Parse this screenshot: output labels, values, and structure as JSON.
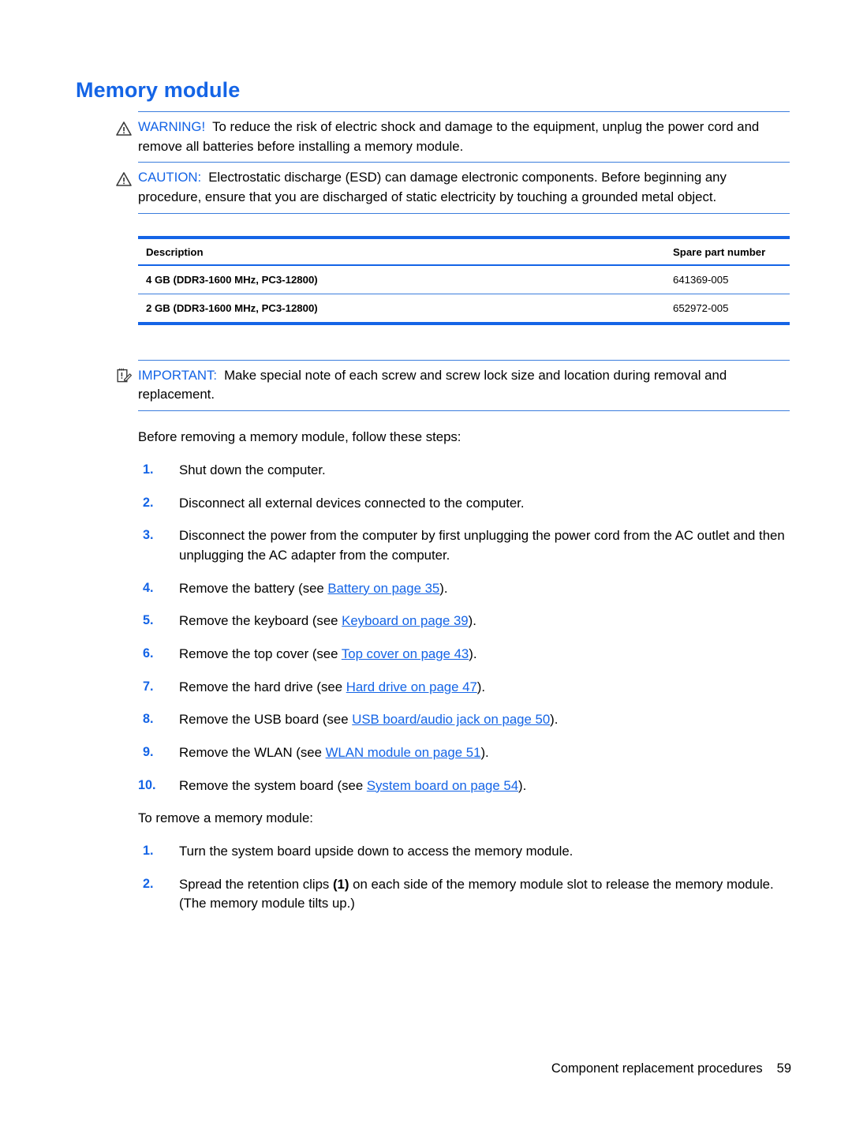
{
  "page": {
    "title": "Memory module",
    "heading_color": "#1464E6"
  },
  "admonitions": [
    {
      "icon": "warning-triangle-icon",
      "label": "WARNING!",
      "text": "To reduce the risk of electric shock and damage to the equipment, unplug the power cord and remove all batteries before installing a memory module."
    },
    {
      "icon": "warning-triangle-icon",
      "label": "CAUTION:",
      "text": "Electrostatic discharge (ESD) can damage electronic components. Before beginning any procedure, ensure that you are discharged of static electricity by touching a grounded metal object."
    }
  ],
  "important": {
    "icon": "notepad-pencil-icon",
    "label": "IMPORTANT:",
    "text": "Make special note of each screw and screw lock size and location during removal and replacement."
  },
  "table": {
    "headers": [
      "Description",
      "Spare part number"
    ],
    "rows": [
      {
        "description": "4 GB (DDR3-1600 MHz, PC3-12800)",
        "spare_part_number": "641369-005"
      },
      {
        "description": "2 GB (DDR3-1600 MHz, PC3-12800)",
        "spare_part_number": "652972-005"
      }
    ]
  },
  "intro_paragraph": "Before removing a memory module, follow these steps:",
  "prep_steps": [
    {
      "num": "1.",
      "pre": "Shut down the computer.",
      "link": "",
      "post": ""
    },
    {
      "num": "2.",
      "pre": "Disconnect all external devices connected to the computer.",
      "link": "",
      "post": ""
    },
    {
      "num": "3.",
      "pre": "Disconnect the power from the computer by first unplugging the power cord from the AC outlet and then unplugging the AC adapter from the computer.",
      "link": "",
      "post": ""
    },
    {
      "num": "4.",
      "pre": "Remove the battery (see ",
      "link": "Battery on page 35",
      "post": ")."
    },
    {
      "num": "5.",
      "pre": "Remove the keyboard (see ",
      "link": "Keyboard on page 39",
      "post": ")."
    },
    {
      "num": "6.",
      "pre": "Remove the top cover (see ",
      "link": "Top cover on page 43",
      "post": ")."
    },
    {
      "num": "7.",
      "pre": "Remove the hard drive (see ",
      "link": "Hard drive on page 47",
      "post": ")."
    },
    {
      "num": "8.",
      "pre": "Remove the USB board (see ",
      "link": "USB board/audio jack on page 50",
      "post": ")."
    },
    {
      "num": "9.",
      "pre": "Remove the WLAN (see ",
      "link": "WLAN module on page 51",
      "post": ")."
    },
    {
      "num": "10.",
      "pre": "Remove the system board (see ",
      "link": "System board on page 54",
      "post": ")."
    }
  ],
  "remove_paragraph": "To remove a memory module:",
  "remove_steps": [
    {
      "num": "1.",
      "pre": "Turn the system board upside down to access the memory module.",
      "bold": "",
      "post": ""
    },
    {
      "num": "2.",
      "pre": "Spread the retention clips ",
      "bold": "(1)",
      "post": " on each side of the memory module slot to release the memory module. (The memory module tilts up.)"
    }
  ],
  "footer": {
    "label": "Component replacement procedures",
    "page_number": "59"
  }
}
